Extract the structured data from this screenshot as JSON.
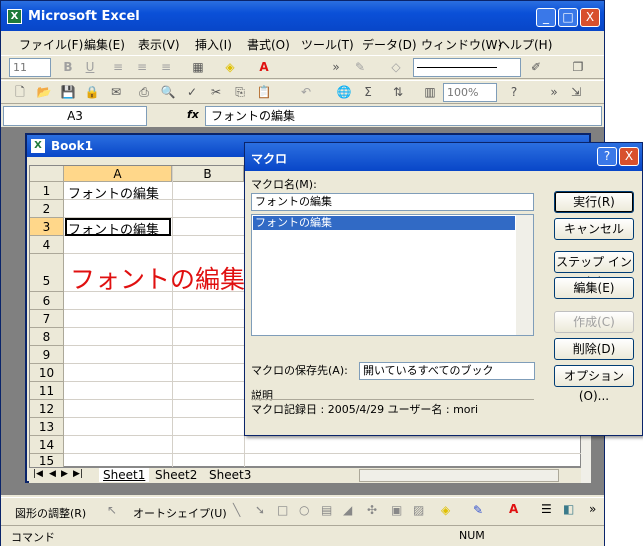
{
  "app": {
    "title": "Microsoft Excel",
    "icon_letter": "X"
  },
  "window_buttons": {
    "minimize": "_",
    "maximize": "□",
    "close": "X"
  },
  "menu": [
    "ファイル(F)",
    "編集(E)",
    "表示(V)",
    "挿入(I)",
    "書式(O)",
    "ツール(T)",
    "データ(D)",
    "ウィンドウ(W)",
    "ヘルプ(H)"
  ],
  "toolbar": {
    "font_size": "11",
    "zoom": "100%"
  },
  "formula_bar": {
    "name_box": "A3",
    "fx": "fx",
    "content": "フォントの編集"
  },
  "workbook": {
    "title": "Book1",
    "columns": [
      "A",
      "B"
    ],
    "rows": [
      "1",
      "2",
      "3",
      "4",
      "5",
      "6",
      "7",
      "8",
      "9",
      "10",
      "11",
      "12",
      "13",
      "14",
      "15"
    ],
    "cells": {
      "a1": "フォントの編集",
      "a3": "フォントの編集",
      "a5": "フォントの編集"
    },
    "sheets": [
      "Sheet1",
      "Sheet2",
      "Sheet3"
    ],
    "nav": [
      "|◀",
      "◀",
      "▶",
      "▶|"
    ]
  },
  "dialog": {
    "title": "マクロ",
    "help": "?",
    "close": "X",
    "name_label": "マクロ名(M):",
    "name_value": "フォントの編集",
    "list_items": [
      "フォントの編集"
    ],
    "store_label": "マクロの保存先(A):",
    "store_value": "開いているすべてのブック",
    "desc_label": "説明",
    "desc_text": "マクロ記録日 : 2005/4/29  ユーザー名 : mori",
    "buttons": {
      "run": "実行(R)",
      "cancel": "キャンセル",
      "step": "ステップ イン(S)",
      "edit": "編集(E)",
      "create": "作成(C)",
      "delete": "削除(D)",
      "options": "オプション(O)..."
    }
  },
  "drawing_toolbar": {
    "draw": "図形の調整(R)",
    "autoshape": "オートシェイプ(U)"
  },
  "status": {
    "left": "コマンド",
    "num": "NUM"
  },
  "colors": {
    "title_blue": "#0846c8",
    "red_text": "#e01010",
    "selection": "#316ac5"
  }
}
